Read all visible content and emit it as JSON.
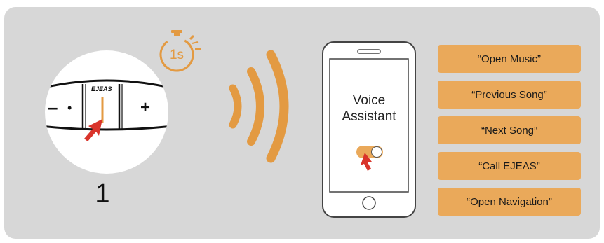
{
  "device": {
    "brand": "EJEAS",
    "minus_label": "–",
    "plus_label": "+",
    "dot_label": "•"
  },
  "step_number": "1",
  "timer": {
    "label": "1s",
    "icon": "stopwatch-icon"
  },
  "signal": {
    "icon": "sound-wave-icon"
  },
  "phone": {
    "title_line1": "Voice",
    "title_line2": "Assistant",
    "toggle_state": "on",
    "cursor_icon": "hand-pointer-arrow-icon"
  },
  "commands": [
    "“Open Music”",
    "“Previous Song”",
    "“Next Song”",
    "“Call EJEAS”",
    "“Open Navigation”"
  ],
  "colors": {
    "panel": "#d7d7d7",
    "accent": "#eaa95a",
    "wave": "#e39a42",
    "pointer": "#d9342b"
  }
}
